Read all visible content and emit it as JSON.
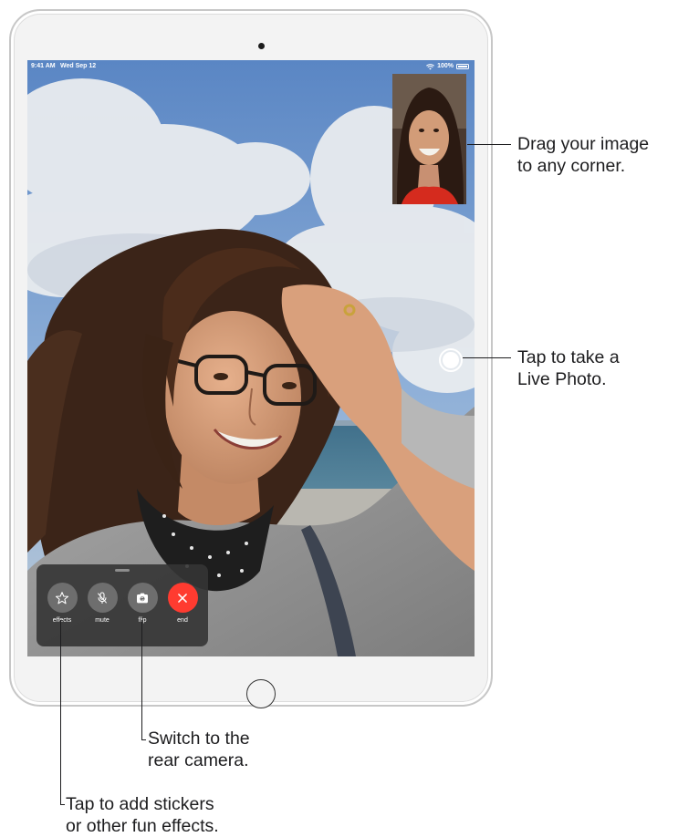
{
  "status_bar": {
    "time": "9:41 AM",
    "date": "Wed Sep 12",
    "battery": "100%",
    "wifi_icon": "wifi-icon",
    "battery_icon": "battery-icon"
  },
  "controls": [
    {
      "key": "effects",
      "label": "effects",
      "icon": "star-icon"
    },
    {
      "key": "mute",
      "label": "mute",
      "icon": "mic-slash-icon"
    },
    {
      "key": "flip",
      "label": "flip",
      "icon": "camera-flip-icon"
    },
    {
      "key": "end",
      "label": "end",
      "icon": "close-icon"
    }
  ],
  "colors": {
    "end_call": "#ff3b30",
    "control_bg": "#6e6e6e",
    "panel_bg": "#343434"
  },
  "callouts": {
    "drag": [
      "Drag your image",
      "to any corner."
    ],
    "live_photo": [
      "Tap to take a",
      "Live Photo."
    ],
    "flip": [
      "Switch to the",
      "rear camera."
    ],
    "effects": [
      "Tap to add stickers",
      "or other fun effects."
    ]
  }
}
